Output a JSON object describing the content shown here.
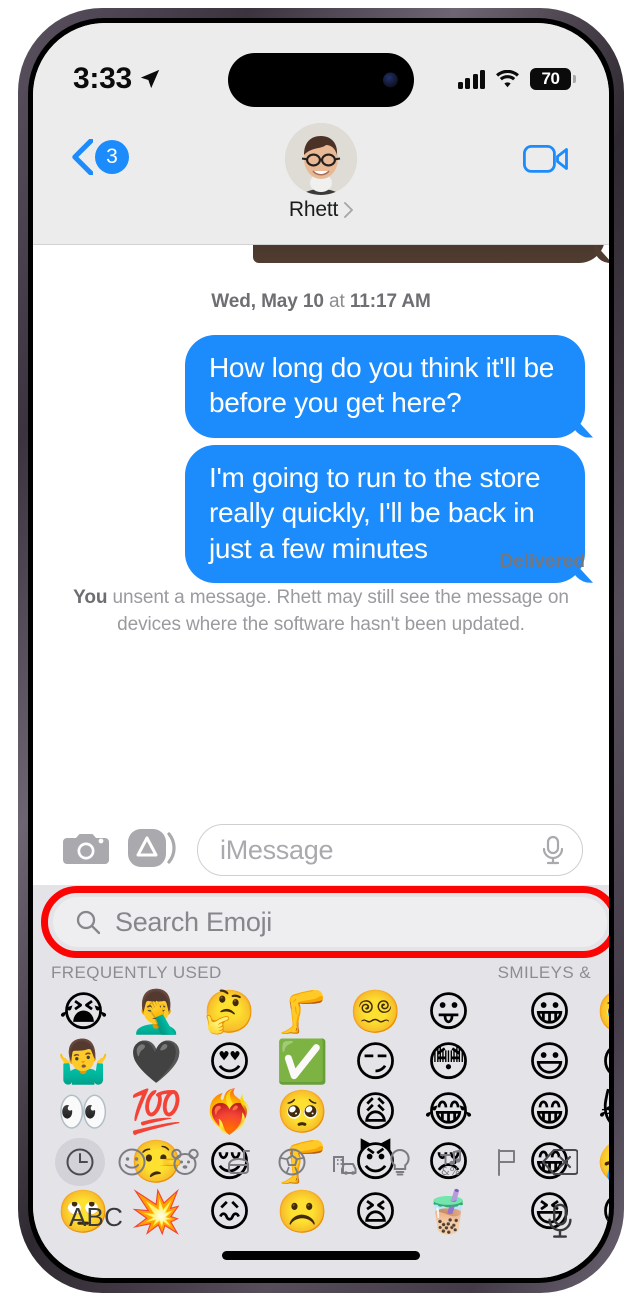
{
  "status_bar": {
    "time": "3:33",
    "location_icon": "location-arrow-icon",
    "signal_icon": "cellular-bars-icon",
    "wifi_icon": "wifi-icon",
    "battery_percent": "70"
  },
  "nav_bar": {
    "back_icon": "chevron-left-icon",
    "unread_badge": "3",
    "contact_name": "Rhett",
    "contact_chevron_icon": "chevron-right-icon",
    "avatar_name": "contact-avatar",
    "facetime_icon": "video-camera-icon"
  },
  "conversation": {
    "timestamp": "Wed, May 10 at 11:17 AM",
    "timestamp_day": "Wed, May 10",
    "timestamp_at": " at ",
    "timestamp_time": "11:17 AM",
    "messages": [
      {
        "text": "How long do you think it'll be before you get here?",
        "sender": "me"
      },
      {
        "text": "I'm going to run to the store really quickly, I'll be back in just a few minutes",
        "sender": "me"
      }
    ],
    "delivered_label": "Delivered",
    "unsent_prefix": "You",
    "unsent_text": " unsent a message. Rhett may still see the message on devices where the software hasn't been updated."
  },
  "input_row": {
    "camera_icon": "camera-icon",
    "apps_icon": "app-store-icon",
    "placeholder": "iMessage",
    "mic_icon": "microphone-icon"
  },
  "emoji_keyboard": {
    "search_icon": "magnifier-icon",
    "search_placeholder": "Search Emoji",
    "highlight_color": "#fb0404",
    "section_left": "FREQUENTLY USED",
    "section_right": "SMILEYS &",
    "frequently_used": [
      "😭",
      "🤦‍♂️",
      "🤔",
      "🦵",
      "😵‍💫",
      "😛",
      "🤷‍♂️",
      "🖤",
      "😍",
      "✅",
      "😏",
      "😳",
      "👀",
      "💯",
      "❤️‍🔥",
      "🥺",
      "😩",
      "😂",
      "😔",
      "🤥",
      "😌",
      "🦵",
      "😈",
      "😢",
      "🙄",
      "💥",
      "😖",
      "☹️",
      "😫",
      "🧋"
    ],
    "smileys": [
      "😀",
      "🥹",
      "😃",
      "😄",
      "😁",
      "😹",
      "😁",
      "🤣",
      "😆",
      "😅"
    ],
    "categories": [
      {
        "name": "recent",
        "icon": "clock-icon",
        "selected": true
      },
      {
        "name": "smileys",
        "icon": "smiley-icon",
        "selected": false
      },
      {
        "name": "animals",
        "icon": "bear-icon",
        "selected": false
      },
      {
        "name": "food",
        "icon": "food-icon",
        "selected": false
      },
      {
        "name": "activity",
        "icon": "soccer-ball-icon",
        "selected": false
      },
      {
        "name": "travel",
        "icon": "car-building-icon",
        "selected": false
      },
      {
        "name": "objects",
        "icon": "lightbulb-icon",
        "selected": false
      },
      {
        "name": "symbols",
        "icon": "symbols-icon",
        "selected": false
      },
      {
        "name": "flags",
        "icon": "flag-icon",
        "selected": false
      }
    ],
    "delete_icon": "backspace-delete-icon",
    "abc_label": "ABC",
    "dictation_icon": "microphone-icon"
  }
}
